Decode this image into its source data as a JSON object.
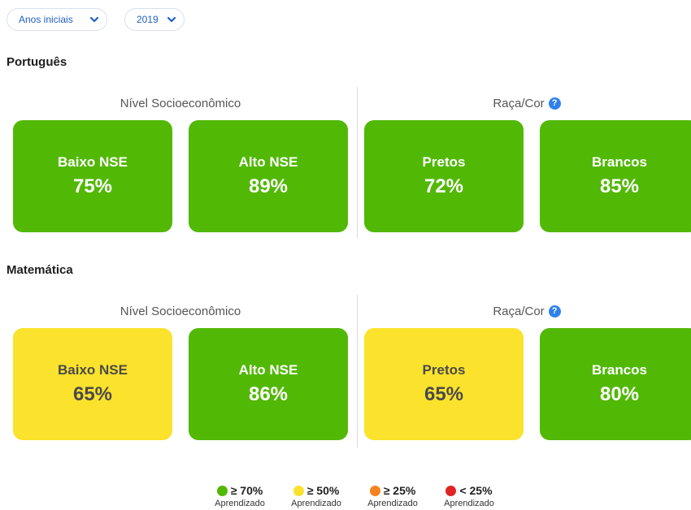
{
  "filters": [
    {
      "value": "Anos iniciais"
    },
    {
      "value": "2019"
    }
  ],
  "sections": [
    {
      "title": "Português",
      "groups": [
        {
          "label": "Nível Socioeconômico",
          "help_icon": false
        },
        {
          "label": "Raça/Cor",
          "help_icon": true
        }
      ],
      "cards": [
        {
          "label": "Baixo NSE",
          "value": "75%",
          "color": "#52b806"
        },
        {
          "label": "Alto NSE",
          "value": "89%",
          "color": "#52b806"
        },
        {
          "label": "Pretos",
          "value": "72%",
          "color": "#52b806"
        },
        {
          "label": "Brancos",
          "value": "85%",
          "color": "#52b806"
        }
      ]
    },
    {
      "title": "Matemática",
      "groups": [
        {
          "label": "Nível Socioeconômico",
          "help_icon": false
        },
        {
          "label": "Raça/Cor",
          "help_icon": true
        }
      ],
      "cards": [
        {
          "label": "Baixo NSE",
          "value": "65%",
          "color": "#fbe22c"
        },
        {
          "label": "Alto NSE",
          "value": "86%",
          "color": "#52b806"
        },
        {
          "label": "Pretos",
          "value": "65%",
          "color": "#fbe22c"
        },
        {
          "label": "Brancos",
          "value": "80%",
          "color": "#52b806"
        }
      ]
    }
  ],
  "help_icon_glyph": "?",
  "legend": [
    {
      "threshold": "≥ 70%",
      "label": "Aprendizado",
      "color": "#52b806"
    },
    {
      "threshold": "≥ 50%",
      "label": "Aprendizado",
      "color": "#fbe22c"
    },
    {
      "threshold": "≥ 25%",
      "label": "Aprendizado",
      "color": "#f5821f"
    },
    {
      "threshold": "< 25%",
      "label": "Aprendizado",
      "color": "#e02424"
    }
  ]
}
